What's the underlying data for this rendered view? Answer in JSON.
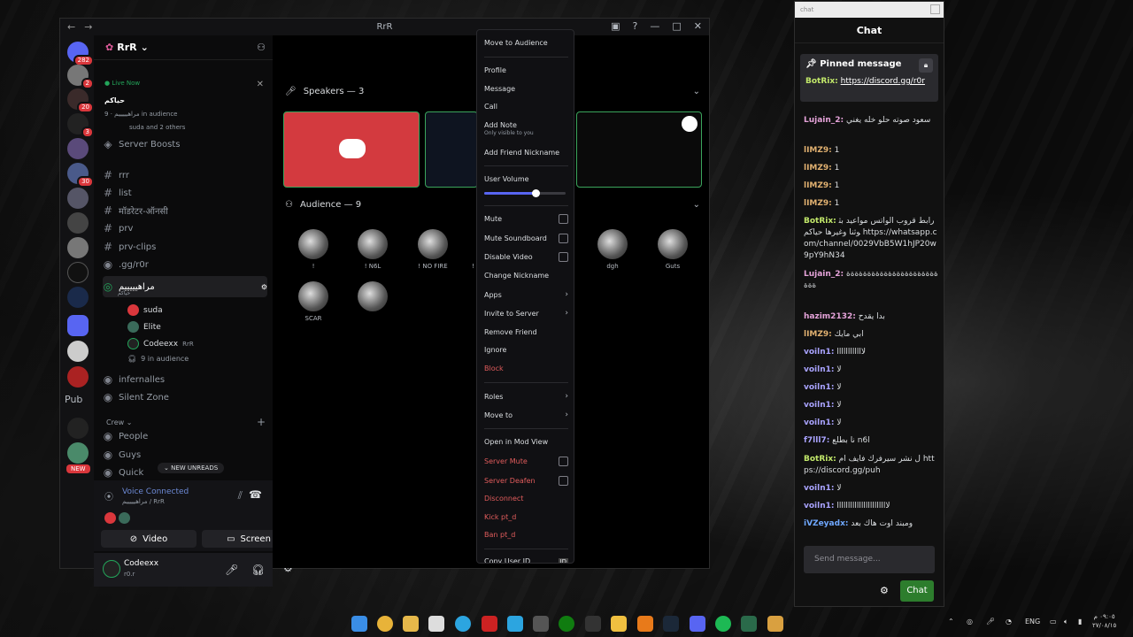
{
  "window": {
    "title": "RrR"
  },
  "guild_badges": [
    "282",
    "2",
    "20",
    "3",
    "30"
  ],
  "guild_text": "Pub",
  "guild_new": "NEW",
  "server": {
    "name": "RrR",
    "live": "Live Now",
    "live_title": "حياكم",
    "live_sub": "مراهيييييم · 9 in audience",
    "live_sub2": "suda and 2 others",
    "boosts": "Server Boosts"
  },
  "channels": [
    {
      "icon": "#",
      "name": "rrr"
    },
    {
      "icon": "#",
      "name": "list"
    },
    {
      "icon": "#",
      "name": "मॉडरेटर-ऑनसी"
    },
    {
      "icon": "#",
      "name": "prv"
    },
    {
      "icon": "#",
      "name": "prv-clips"
    },
    {
      "icon": "◉",
      "name": ".gg/r0r"
    }
  ],
  "stage_channel": {
    "name": "مراهيييييم",
    "sub": "حياكم"
  },
  "stage_members": [
    "suda",
    "Elite",
    "Codeexx",
    "9 in audience"
  ],
  "stage_member_tag": "RrR",
  "voice_channels": [
    "infernalles",
    "Silent Zone"
  ],
  "category": "Crew",
  "crew_channels": [
    "People",
    "Guys",
    "Quick"
  ],
  "new_unreads": "NEW UNREADS",
  "voice": {
    "status": "Voice Connected",
    "sub": "مراهيييييم / RrR",
    "video": "Video",
    "screen": "Screen"
  },
  "user": {
    "name": "Codeexx",
    "status": "r0.r"
  },
  "stage": {
    "speakers": "Speakers — 3",
    "audience": "Audience — 9"
  },
  "audience": [
    "!",
    "! N6L",
    "! NO FIRE",
    "! A",
    "dgh",
    "Guts",
    "SCAR",
    ""
  ],
  "context_menu": {
    "move_to_audience": "Move to Audience",
    "profile": "Profile",
    "message": "Message",
    "call": "Call",
    "add_note": "Add Note",
    "add_note_sub": "Only visible to you",
    "add_friend_nickname": "Add Friend Nickname",
    "user_volume": "User Volume",
    "user_volume_level": 0.64,
    "mute": "Mute",
    "mute_soundboard": "Mute Soundboard",
    "disable_video": "Disable Video",
    "change_nickname": "Change Nickname",
    "apps": "Apps",
    "invite": "Invite to Server",
    "remove_friend": "Remove Friend",
    "ignore": "Ignore",
    "block": "Block",
    "roles": "Roles",
    "move_to": "Move to",
    "mod_view": "Open in Mod View",
    "server_mute": "Server Mute",
    "server_deafen": "Server Deafen",
    "disconnect": "Disconnect",
    "kick": "Kick pt_d",
    "ban": "Ban pt_d",
    "copy_id": "Copy User ID"
  },
  "chat": {
    "window_title": "chat",
    "header": "Chat",
    "pinned_title": "Pinned message",
    "pinned_user": "BotRix:",
    "pinned_link": "https://discord.gg/r0r",
    "messages": [
      {
        "user": "Lujain_2:",
        "text": "سعود صوته حلو خله يغني",
        "color": "#e5a3d9"
      },
      {
        "user": "lIMZ9:",
        "text": "1",
        "color": "#e0b070"
      },
      {
        "user": "lIMZ9:",
        "text": "1",
        "color": "#e0b070"
      },
      {
        "user": "lIMZ9:",
        "text": "1",
        "color": "#e0b070"
      },
      {
        "user": "lIMZ9:",
        "text": "1",
        "color": "#e0b070"
      },
      {
        "user": "BotRix:",
        "text": "رابط قروب الواتس مواعيد بثوثنا وغيرها حياكم https://whatsapp.com/channel/0029VbB5W1hJP20w9pY9hN34",
        "color": "#c2e86a"
      },
      {
        "user": "Lujain_2:",
        "text": "ةةةةةةةةةةةةةةةةةةةةةةةةة",
        "color": "#e5a3d9"
      },
      {
        "user": "hazim2132:",
        "text": "بدا يقدح",
        "color": "#e5a3d9"
      },
      {
        "user": "lIMZ9:",
        "text": "ابي مايك",
        "color": "#e0b070"
      },
      {
        "user": "voiln1:",
        "text": "لاااااااااااا",
        "color": "#a9a3ff"
      },
      {
        "user": "voiln1:",
        "text": "لا",
        "color": "#a9a3ff"
      },
      {
        "user": "voiln1:",
        "text": "لا",
        "color": "#a9a3ff"
      },
      {
        "user": "voiln1:",
        "text": "لا",
        "color": "#a9a3ff"
      },
      {
        "user": "voiln1:",
        "text": "لا",
        "color": "#a9a3ff"
      },
      {
        "user": "f7lll7:",
        "text": "نا بطلع n6l",
        "color": "#a9a3ff"
      },
      {
        "user": "BotRix:",
        "text": "ل نشر سيرفرك فايف ام https://discord.gg/puh",
        "color": "#c2e86a"
      },
      {
        "user": "voiln1:",
        "text": "لا",
        "color": "#a9a3ff"
      },
      {
        "user": "voiln1:",
        "text": "لااااااااااااااااااااااا",
        "color": "#a9a3ff"
      },
      {
        "user": "iVZeyadx:",
        "text": "ومبند اوت هاك بعد",
        "color": "#6fa8ff"
      }
    ],
    "placeholder": "Send message...",
    "send": "Chat"
  },
  "taskbar": {
    "lang": "ENG",
    "time": "٠٩:٠٥ م",
    "date": "٢٧/٠٨/١٥"
  }
}
